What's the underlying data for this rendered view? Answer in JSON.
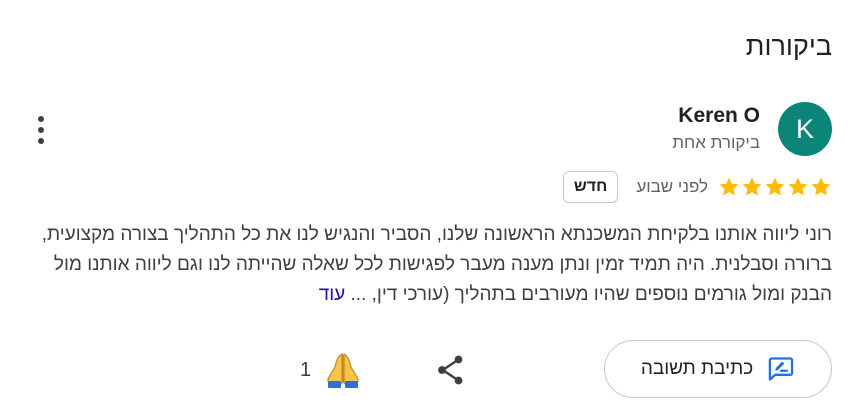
{
  "section": {
    "title": "ביקורות"
  },
  "review": {
    "avatar_letter": "K",
    "avatar_color": "#0b8577",
    "author": "Keren O",
    "author_meta": "ביקורת אחת",
    "rating": 5,
    "rating_max": 5,
    "star_color": "#fbbc04",
    "date": "לפני שבוע",
    "badge": "חדש",
    "text": "רוני ליווה אותנו בלקיחת המשכנתא הראשונה שלנו, הסביר והנגיש לנו את כל התהליך בצורה מקצועית, ברורה וסבלנית. היה תמיד זמין ונתן מענה מעבר לפגישות לכל שאלה שהייתה לנו וגם ליווה אותנו מול הבנק ומול גורמים נוספים שהיו מעורבים בתהליך (עורכי דין, ...",
    "more_label": "עוד"
  },
  "actions": {
    "reply_label": "כתיבת תשובה",
    "reaction_count": "1",
    "reaction_icon": "folded-hands-emoji",
    "share_icon": "share-icon",
    "menu_icon": "more-vert-icon",
    "reply_icon": "rate-review-icon",
    "accent_color": "#1a73e8"
  }
}
